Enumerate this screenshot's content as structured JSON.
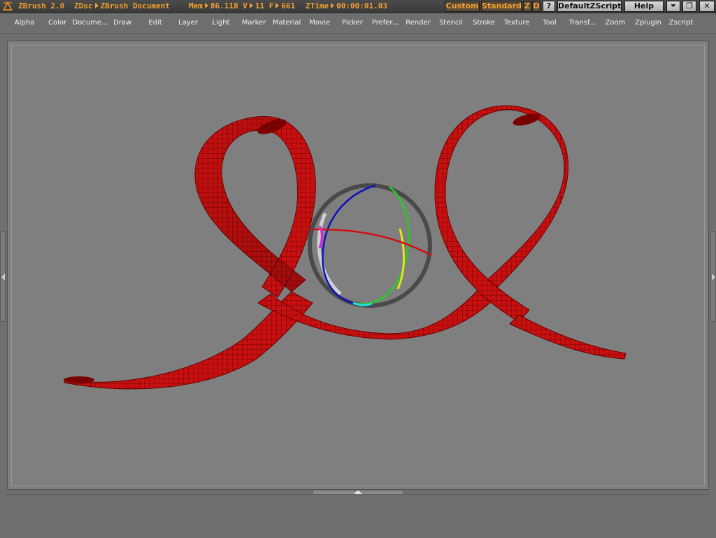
{
  "titlebar": {
    "app": "ZBrush 2.0",
    "doc_prefix": "ZDoc",
    "doc_name": "ZBrush Document",
    "mem_label": "Mem",
    "mem_value": "86.118",
    "v_label": "V",
    "v_value": "11",
    "f_label": "F",
    "f_value": "661",
    "ztime_label": "ZTime",
    "ztime_value": "00:00:01.03",
    "buttons": {
      "custom": "Custom",
      "standard": "Standard",
      "z": "Z",
      "d": "D",
      "help_q": "?",
      "default_zscript": "DefaultZScript",
      "help": "Help",
      "minimize": "⏷",
      "restore": "❐",
      "close": "✕"
    }
  },
  "menu": [
    "Alpha",
    "Color",
    "Docume...",
    "Draw",
    "Edit",
    "Layer",
    "Light",
    "Marker",
    "Material",
    "Movie",
    "Picker",
    "Prefer...",
    "Render",
    "Stencil",
    "Stroke",
    "Texture",
    "Tool",
    "Transf...",
    "Zoom",
    "Zplugin",
    "Zscript"
  ],
  "colors": {
    "accent": "#f0a030",
    "ribbon": "#c81010",
    "canvas": "#808080"
  },
  "icons": {
    "logo": "zbrush-logo-icon",
    "left_handle": "chevron-left-icon",
    "right_handle": "chevron-right-icon",
    "bottom_handle": "chevron-up-icon"
  }
}
